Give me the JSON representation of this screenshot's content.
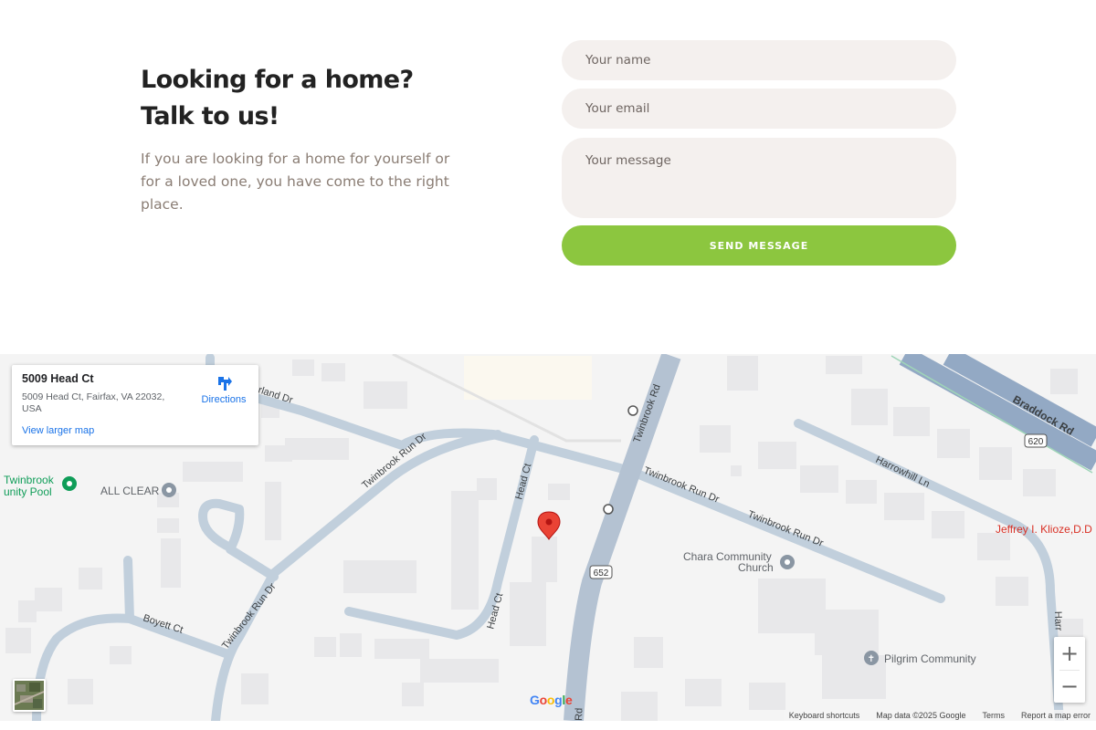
{
  "contact": {
    "heading_line1": "Looking for a home?",
    "heading_line2": "Talk to us!",
    "intro": "If you are looking for a home for yourself or for a loved one, you have come to the right place.",
    "name_placeholder": "Your name",
    "email_placeholder": "Your email",
    "message_placeholder": "Your message",
    "send_label": "SEND MESSAGE",
    "accent_color": "#8cc63f"
  },
  "map": {
    "card": {
      "title": "5009 Head Ct",
      "address": "5009 Head Ct, Fairfax, VA 22032, USA",
      "directions_label": "Directions",
      "larger_map_label": "View larger map"
    },
    "roads": {
      "twinbrook_rd": "Twinbrook Rd",
      "twinbrook_run_dr": "Twinbrook Run Dr",
      "braddock_rd": "Braddock Rd",
      "harrowhill_ln": "Harrowhill Ln",
      "head_ct": "Head Ct",
      "boyett_ct": "Boyett Ct",
      "fairland_dr": "rland Dr",
      "route_620": "620",
      "route_652": "652",
      "rd_stub": "Rd",
      "harr_stub": "Harr"
    },
    "pois": {
      "pool_line1": "Twinbrook",
      "pool_line2": "unity Pool",
      "all_clear": "ALL CLEAR",
      "chara_line1": "Chara Community",
      "chara_line2": "Church",
      "pilgrim": "Pilgrim Community",
      "klioze": "Jeffrey I. Klioze,D.D"
    },
    "zoom_in": "+",
    "zoom_out": "−",
    "google_logo": "Google",
    "attribution": {
      "keyboard": "Keyboard shortcuts",
      "map_data": "Map data ©2025 Google",
      "terms": "Terms",
      "report": "Report a map error"
    },
    "marker_color": "#ea4335"
  }
}
